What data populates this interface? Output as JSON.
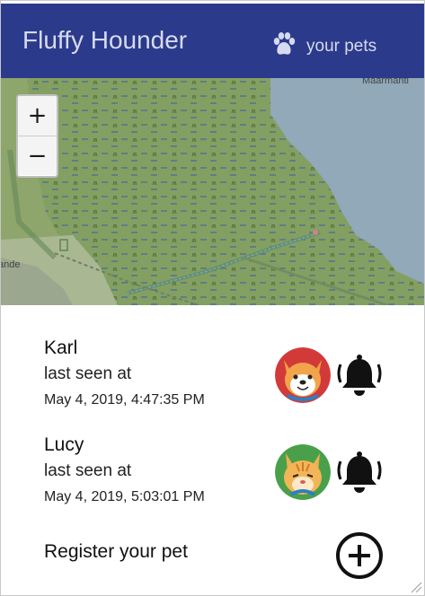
{
  "header": {
    "title": "Fluffy Hounder",
    "pets_link_label": "your pets",
    "pets_icon": "paw-icon"
  },
  "map": {
    "place_label": "Maarmanti",
    "edge_label": "ande",
    "zoom_in_label": "+",
    "zoom_out_label": "−"
  },
  "pets": [
    {
      "name": "Karl",
      "seen_label": "last seen at",
      "time": "May 4, 2019, 4:47:35 PM",
      "avatar": "dog-avatar",
      "action_icon": "alarm-bell-icon"
    },
    {
      "name": "Lucy",
      "seen_label": "last seen at",
      "time": "May 4, 2019, 5:03:01 PM",
      "avatar": "cat-avatar",
      "action_icon": "alarm-bell-icon"
    }
  ],
  "register": {
    "label": "Register your pet",
    "icon": "plus-circle-icon"
  },
  "colors": {
    "header_bg": "#2b3a8a",
    "header_text": "#d6daf0",
    "map_marsh": "#8fae6b",
    "map_water": "#9eb8c9"
  }
}
